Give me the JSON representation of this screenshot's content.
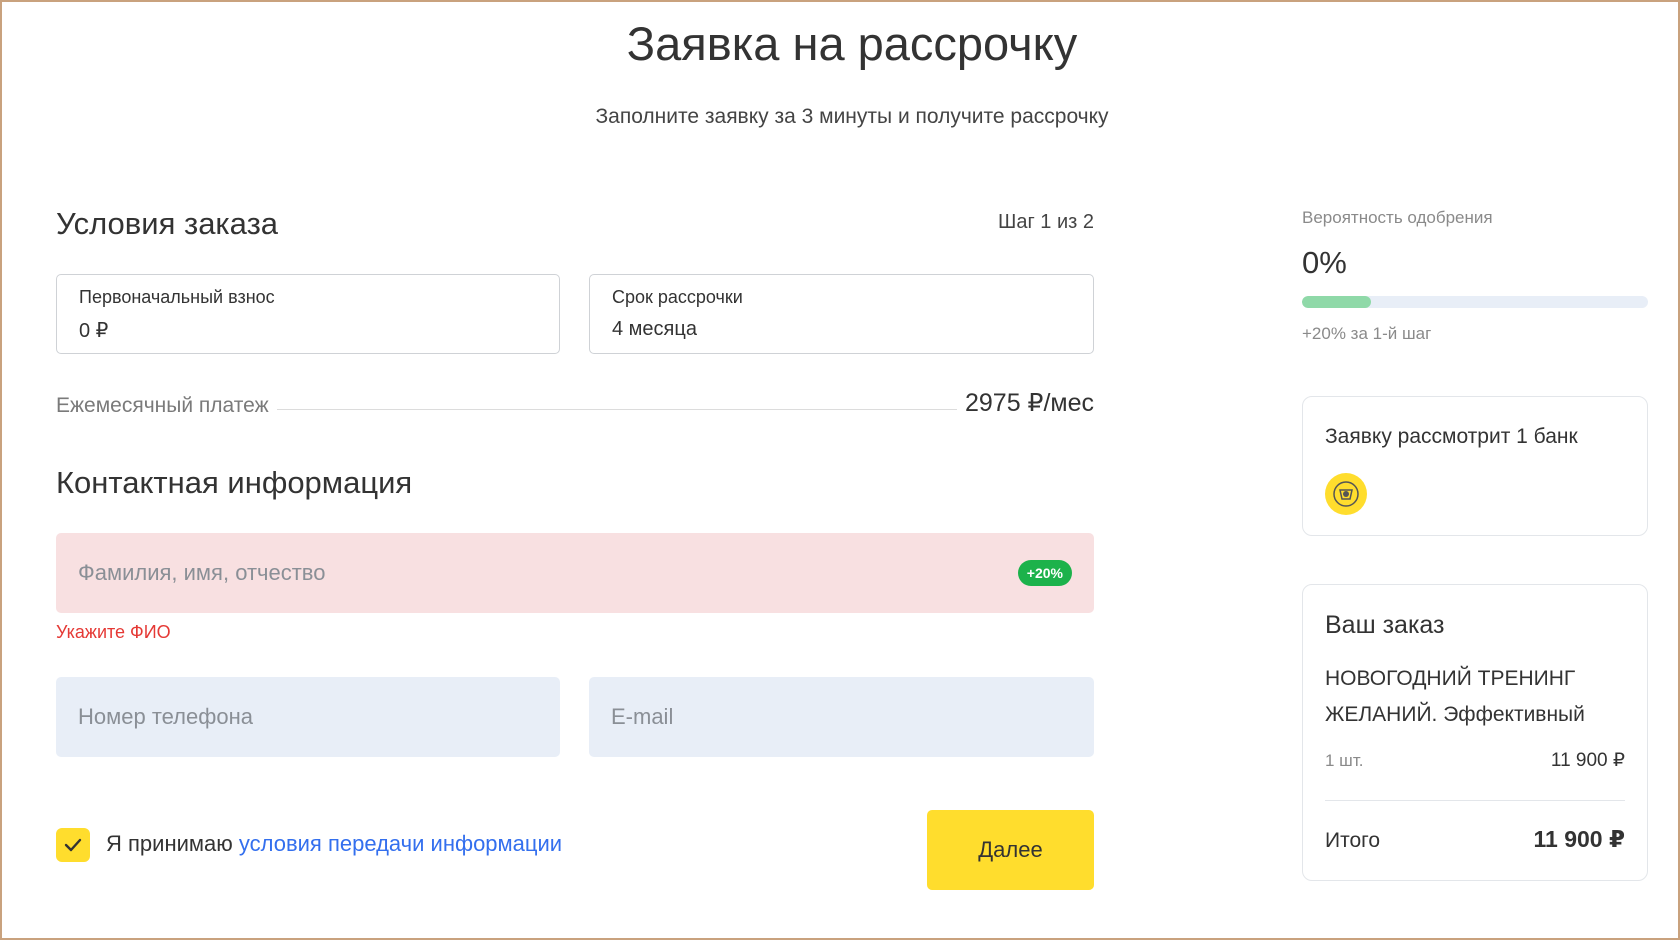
{
  "header": {
    "title": "Заявка на рассрочку",
    "subtitle": "Заполните заявку за 3 минуты и получите рассрочку"
  },
  "conditions": {
    "title": "Условия заказа",
    "step": "Шаг 1 из 2",
    "down_payment": {
      "label": "Первоначальный взнос",
      "value": "0 ₽"
    },
    "term": {
      "label": "Срок рассрочки",
      "value": "4 месяца"
    },
    "monthly": {
      "label": "Ежемесячный платеж",
      "value": "2975 ₽/мес"
    }
  },
  "contact": {
    "title": "Контактная информация",
    "full_name": {
      "placeholder": "Фамилия, имя, отчество",
      "badge": "+20%",
      "error": "Укажите ФИО"
    },
    "phone": {
      "placeholder": "Номер телефона"
    },
    "email": {
      "placeholder": "E-mail"
    },
    "consent": {
      "checked": true,
      "text": "Я принимаю",
      "link": "условия передачи информации"
    },
    "next_label": "Далее"
  },
  "approval": {
    "label": "Вероятность одобрения",
    "value": "0%",
    "progress_fraction": 0.2,
    "hint": "+20% за 1-й шаг"
  },
  "bank_card": {
    "title": "Заявку рассмотрит 1 банк",
    "logo_icon": "bank-logo-icon"
  },
  "order": {
    "title": "Ваш заказ",
    "product": "НОВОГОДНИЙ ТРЕНИНГ ЖЕЛАНИЙ. Эффективный",
    "qty": "1 шт.",
    "price": "11 900 ₽",
    "total_label": "Итого",
    "total_value": "11 900 ₽"
  },
  "colors": {
    "accent": "#ffdd2d",
    "error": "#e53935",
    "link": "#336fee",
    "badge": "#1cb24b",
    "progress": "#8fd9a8"
  }
}
